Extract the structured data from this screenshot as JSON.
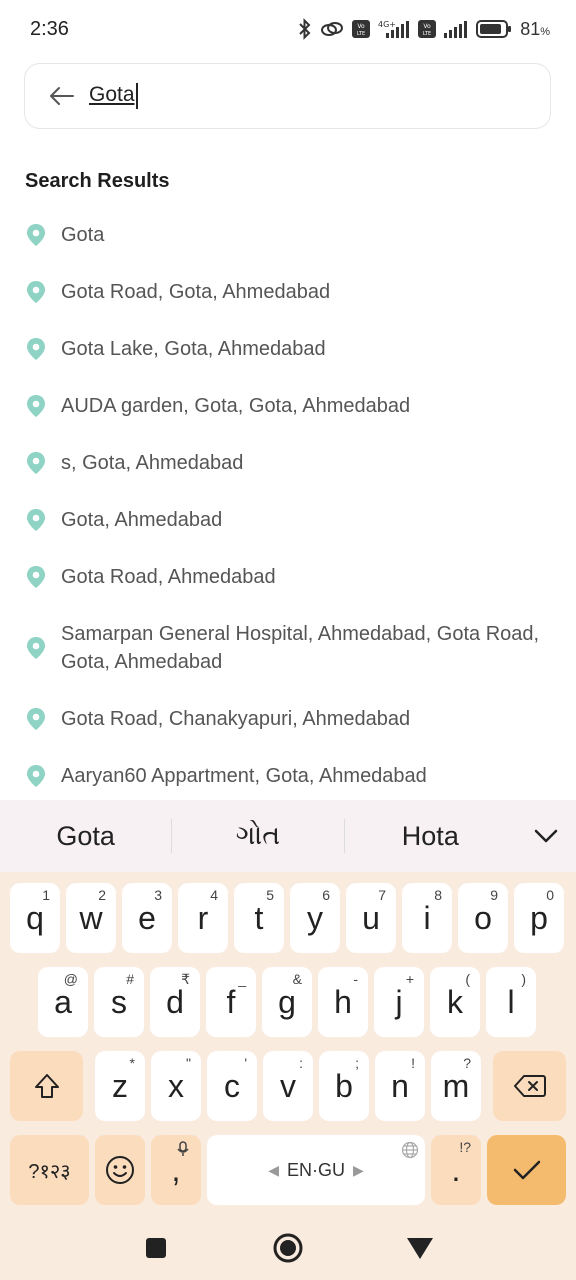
{
  "status_bar": {
    "time": "2:36",
    "battery_percent": "81",
    "battery_unit": "%",
    "network": "4G+",
    "volte": "Vo LTE"
  },
  "search": {
    "query": "Gota"
  },
  "results": {
    "title": "Search Results",
    "items": [
      {
        "label": "Gota"
      },
      {
        "label": "Gota Road, Gota, Ahmedabad"
      },
      {
        "label": "Gota Lake, Gota, Ahmedabad"
      },
      {
        "label": "AUDA garden, Gota, Gota, Ahmedabad"
      },
      {
        "label": "s, Gota, Ahmedabad"
      },
      {
        "label": "Gota, Ahmedabad"
      },
      {
        "label": "Gota Road, Ahmedabad"
      },
      {
        "label": "Samarpan General Hospital, Ahmedabad, Gota Road, Gota, Ahmedabad"
      },
      {
        "label": "Gota Road, Chanakyapuri, Ahmedabad"
      },
      {
        "label": "Aaryan60 Appartment, Gota, Ahmedabad"
      }
    ]
  },
  "keyboard": {
    "suggestions": [
      "Gota",
      "ગોત",
      "Hota"
    ],
    "row1": [
      {
        "k": "q",
        "h": "1"
      },
      {
        "k": "w",
        "h": "2"
      },
      {
        "k": "e",
        "h": "3"
      },
      {
        "k": "r",
        "h": "4"
      },
      {
        "k": "t",
        "h": "5"
      },
      {
        "k": "y",
        "h": "6"
      },
      {
        "k": "u",
        "h": "7"
      },
      {
        "k": "i",
        "h": "8"
      },
      {
        "k": "o",
        "h": "9"
      },
      {
        "k": "p",
        "h": "0"
      }
    ],
    "row2": [
      {
        "k": "a",
        "h": "@"
      },
      {
        "k": "s",
        "h": "#"
      },
      {
        "k": "d",
        "h": "₹"
      },
      {
        "k": "f",
        "h": "_"
      },
      {
        "k": "g",
        "h": "&"
      },
      {
        "k": "h",
        "h": "-"
      },
      {
        "k": "j",
        "h": "+"
      },
      {
        "k": "k",
        "h": "("
      },
      {
        "k": "l",
        "h": ")"
      }
    ],
    "row3": [
      {
        "k": "z",
        "h": "*"
      },
      {
        "k": "x",
        "h": "\""
      },
      {
        "k": "c",
        "h": "'"
      },
      {
        "k": "v",
        "h": ":"
      },
      {
        "k": "b",
        "h": ";"
      },
      {
        "k": "n",
        "h": "!"
      },
      {
        "k": "m",
        "h": "?"
      }
    ],
    "symbols_label": "?१२३",
    "comma": ",",
    "space_label": "EN·GU",
    "period": ".",
    "period_hint": "!?"
  },
  "colors": {
    "pin": "#8fd3c4",
    "keyboard_bg": "#faebdf",
    "func_key": "#fbdcbd",
    "enter_key": "#f4bb6f"
  }
}
